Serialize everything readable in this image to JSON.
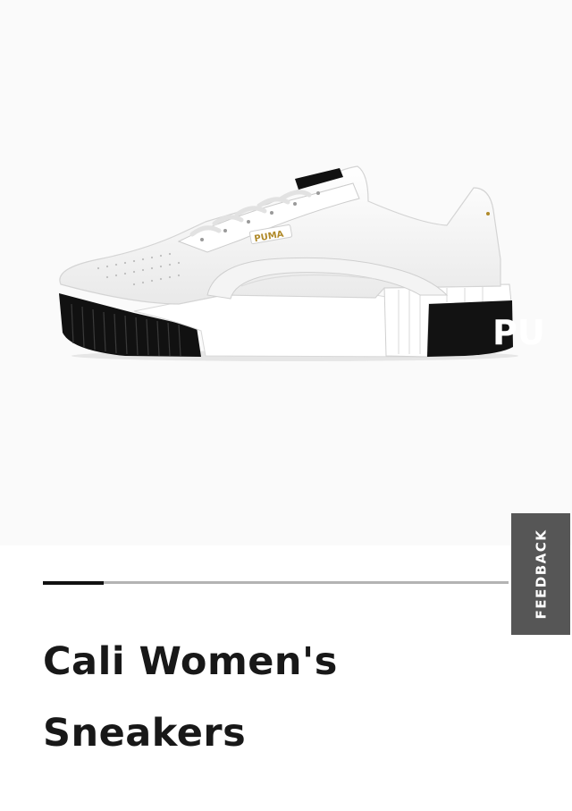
{
  "product": {
    "title": "Cali Women's Sneakers",
    "image_alt": "Cali Women's Sneakers",
    "shoe_logo_text": "PUMA",
    "heel_text": "PU"
  },
  "carousel": {
    "current_slide_fraction": 0.13
  },
  "feedback": {
    "label": "FEEDBACK"
  },
  "colors": {
    "background": "#fafafa",
    "feedback_tab": "#565656",
    "title": "#181818"
  }
}
